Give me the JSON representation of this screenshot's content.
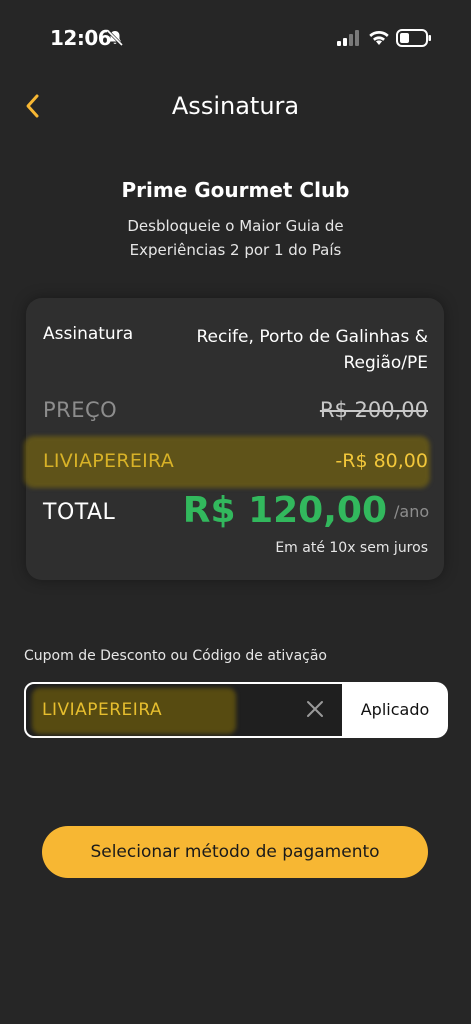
{
  "status_bar": {
    "time": "12:06"
  },
  "header": {
    "title": "Assinatura"
  },
  "club": {
    "title": "Prime Gourmet Club",
    "subtitle": "Desbloqueie o Maior Guia de Experiências 2 por 1 do País"
  },
  "summary": {
    "subscription_label": "Assinatura",
    "location": "Recife, Porto de Galinhas & Região/PE",
    "price_label": "PREÇO",
    "price_value": "R$ 200,00",
    "coupon_label": "LIVIAPEREIRA",
    "coupon_discount": "-R$ 80,00",
    "total_label": "TOTAL",
    "total_value": "R$ 120,00",
    "period": "/ano",
    "installments": "Em até 10x sem juros"
  },
  "coupon": {
    "label": "Cupom de Desconto ou Código de ativação",
    "value": "LIVIAPEREIRA",
    "applied_label": "Aplicado"
  },
  "payment": {
    "button_label": "Selecionar método de pagamento"
  },
  "colors": {
    "background": "#262626",
    "accent": "#f7b733",
    "total_green": "#32b85d",
    "coupon_yellow": "#f2c73a"
  }
}
